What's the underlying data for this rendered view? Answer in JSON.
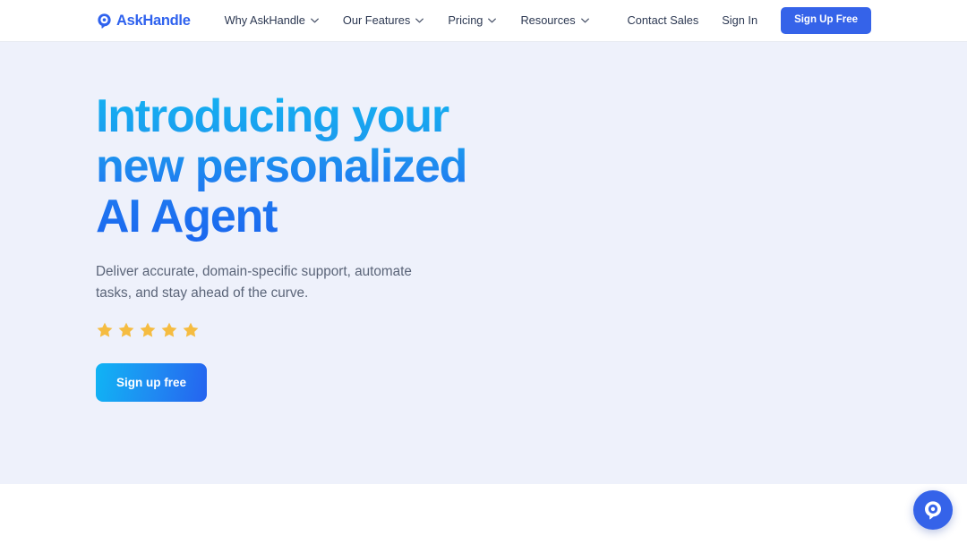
{
  "brand": {
    "name": "AskHandle",
    "mark_icon": "location-pin-circle-icon",
    "color": "#2f62ee"
  },
  "header": {
    "nav_items": [
      {
        "label": "Why AskHandle",
        "has_dropdown": true,
        "icon": "chevron-down-icon"
      },
      {
        "label": "Our Features",
        "has_dropdown": true,
        "icon": "chevron-down-icon"
      },
      {
        "label": "Pricing",
        "has_dropdown": true,
        "icon": "chevron-down-icon"
      },
      {
        "label": "Resources",
        "has_dropdown": true,
        "icon": "chevron-down-icon"
      }
    ],
    "contact_sales_label": "Contact Sales",
    "sign_in_label": "Sign In",
    "sign_up_label": "Sign Up Free",
    "sign_up_color": "#3563e9"
  },
  "hero": {
    "title": "Introducing your new personalized AI Agent",
    "subtitle": "Deliver accurate, domain-specific support, automate tasks, and stay ahead of the curve.",
    "cta_label": "Sign up free",
    "background_color": "#eef1fb",
    "title_gradient_from": "#13b2f2",
    "title_gradient_to": "#1b67ef",
    "cta_gradient_from": "#10b4f4",
    "cta_gradient_to": "#2563ef",
    "rating": {
      "icon": "star-icon",
      "count": 5,
      "color": "#f5bc41"
    }
  },
  "chat_widget": {
    "icon": "chat-bubble-pin-icon",
    "color": "#3563e9"
  }
}
